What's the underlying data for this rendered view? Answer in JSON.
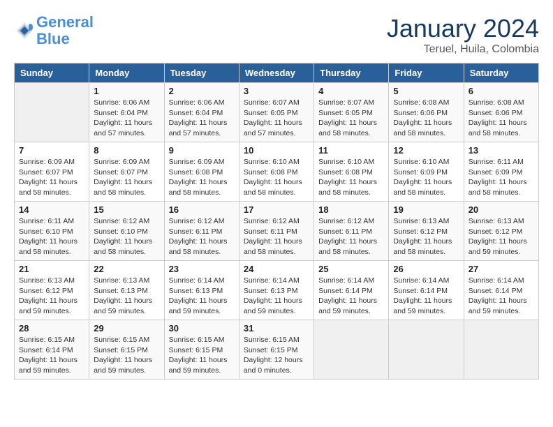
{
  "header": {
    "logo_line1": "General",
    "logo_line2": "Blue",
    "month": "January 2024",
    "location": "Teruel, Huila, Colombia"
  },
  "weekdays": [
    "Sunday",
    "Monday",
    "Tuesday",
    "Wednesday",
    "Thursday",
    "Friday",
    "Saturday"
  ],
  "weeks": [
    [
      {
        "day": "",
        "info": ""
      },
      {
        "day": "1",
        "info": "Sunrise: 6:06 AM\nSunset: 6:04 PM\nDaylight: 11 hours\nand 57 minutes."
      },
      {
        "day": "2",
        "info": "Sunrise: 6:06 AM\nSunset: 6:04 PM\nDaylight: 11 hours\nand 57 minutes."
      },
      {
        "day": "3",
        "info": "Sunrise: 6:07 AM\nSunset: 6:05 PM\nDaylight: 11 hours\nand 57 minutes."
      },
      {
        "day": "4",
        "info": "Sunrise: 6:07 AM\nSunset: 6:05 PM\nDaylight: 11 hours\nand 58 minutes."
      },
      {
        "day": "5",
        "info": "Sunrise: 6:08 AM\nSunset: 6:06 PM\nDaylight: 11 hours\nand 58 minutes."
      },
      {
        "day": "6",
        "info": "Sunrise: 6:08 AM\nSunset: 6:06 PM\nDaylight: 11 hours\nand 58 minutes."
      }
    ],
    [
      {
        "day": "7",
        "info": "Sunrise: 6:09 AM\nSunset: 6:07 PM\nDaylight: 11 hours\nand 58 minutes."
      },
      {
        "day": "8",
        "info": "Sunrise: 6:09 AM\nSunset: 6:07 PM\nDaylight: 11 hours\nand 58 minutes."
      },
      {
        "day": "9",
        "info": "Sunrise: 6:09 AM\nSunset: 6:08 PM\nDaylight: 11 hours\nand 58 minutes."
      },
      {
        "day": "10",
        "info": "Sunrise: 6:10 AM\nSunset: 6:08 PM\nDaylight: 11 hours\nand 58 minutes."
      },
      {
        "day": "11",
        "info": "Sunrise: 6:10 AM\nSunset: 6:08 PM\nDaylight: 11 hours\nand 58 minutes."
      },
      {
        "day": "12",
        "info": "Sunrise: 6:10 AM\nSunset: 6:09 PM\nDaylight: 11 hours\nand 58 minutes."
      },
      {
        "day": "13",
        "info": "Sunrise: 6:11 AM\nSunset: 6:09 PM\nDaylight: 11 hours\nand 58 minutes."
      }
    ],
    [
      {
        "day": "14",
        "info": "Sunrise: 6:11 AM\nSunset: 6:10 PM\nDaylight: 11 hours\nand 58 minutes."
      },
      {
        "day": "15",
        "info": "Sunrise: 6:12 AM\nSunset: 6:10 PM\nDaylight: 11 hours\nand 58 minutes."
      },
      {
        "day": "16",
        "info": "Sunrise: 6:12 AM\nSunset: 6:11 PM\nDaylight: 11 hours\nand 58 minutes."
      },
      {
        "day": "17",
        "info": "Sunrise: 6:12 AM\nSunset: 6:11 PM\nDaylight: 11 hours\nand 58 minutes."
      },
      {
        "day": "18",
        "info": "Sunrise: 6:12 AM\nSunset: 6:11 PM\nDaylight: 11 hours\nand 58 minutes."
      },
      {
        "day": "19",
        "info": "Sunrise: 6:13 AM\nSunset: 6:12 PM\nDaylight: 11 hours\nand 58 minutes."
      },
      {
        "day": "20",
        "info": "Sunrise: 6:13 AM\nSunset: 6:12 PM\nDaylight: 11 hours\nand 59 minutes."
      }
    ],
    [
      {
        "day": "21",
        "info": "Sunrise: 6:13 AM\nSunset: 6:12 PM\nDaylight: 11 hours\nand 59 minutes."
      },
      {
        "day": "22",
        "info": "Sunrise: 6:13 AM\nSunset: 6:13 PM\nDaylight: 11 hours\nand 59 minutes."
      },
      {
        "day": "23",
        "info": "Sunrise: 6:14 AM\nSunset: 6:13 PM\nDaylight: 11 hours\nand 59 minutes."
      },
      {
        "day": "24",
        "info": "Sunrise: 6:14 AM\nSunset: 6:13 PM\nDaylight: 11 hours\nand 59 minutes."
      },
      {
        "day": "25",
        "info": "Sunrise: 6:14 AM\nSunset: 6:14 PM\nDaylight: 11 hours\nand 59 minutes."
      },
      {
        "day": "26",
        "info": "Sunrise: 6:14 AM\nSunset: 6:14 PM\nDaylight: 11 hours\nand 59 minutes."
      },
      {
        "day": "27",
        "info": "Sunrise: 6:14 AM\nSunset: 6:14 PM\nDaylight: 11 hours\nand 59 minutes."
      }
    ],
    [
      {
        "day": "28",
        "info": "Sunrise: 6:15 AM\nSunset: 6:14 PM\nDaylight: 11 hours\nand 59 minutes."
      },
      {
        "day": "29",
        "info": "Sunrise: 6:15 AM\nSunset: 6:15 PM\nDaylight: 11 hours\nand 59 minutes."
      },
      {
        "day": "30",
        "info": "Sunrise: 6:15 AM\nSunset: 6:15 PM\nDaylight: 11 hours\nand 59 minutes."
      },
      {
        "day": "31",
        "info": "Sunrise: 6:15 AM\nSunset: 6:15 PM\nDaylight: 12 hours\nand 0 minutes."
      },
      {
        "day": "",
        "info": ""
      },
      {
        "day": "",
        "info": ""
      },
      {
        "day": "",
        "info": ""
      }
    ]
  ]
}
